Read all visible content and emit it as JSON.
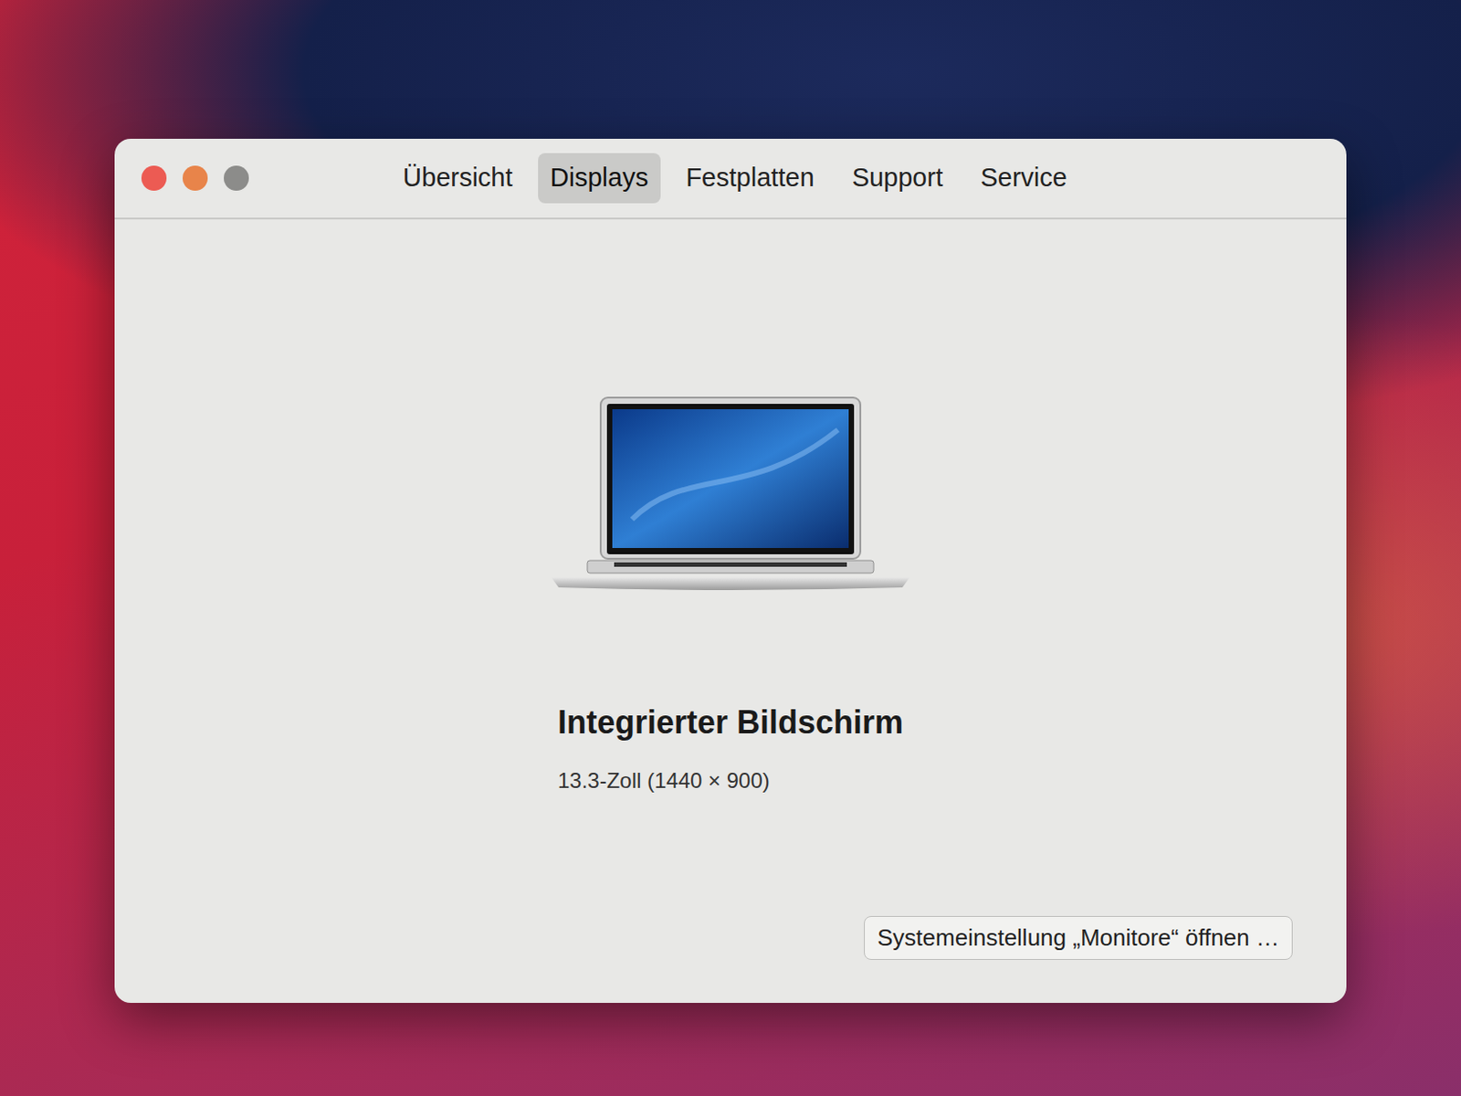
{
  "traffic_lights": [
    {
      "name": "close",
      "color": "#ec5b53"
    },
    {
      "name": "minimize",
      "color": "#e8844a"
    },
    {
      "name": "zoom",
      "color": "#8c8c8a"
    }
  ],
  "tabs": [
    {
      "label": "Übersicht",
      "selected": false
    },
    {
      "label": "Displays",
      "selected": true
    },
    {
      "label": "Festplatten",
      "selected": false
    },
    {
      "label": "Support",
      "selected": false
    },
    {
      "label": "Service",
      "selected": false
    }
  ],
  "display": {
    "name": "Integrierter Bildschirm",
    "detail": "13.3-Zoll (1440 × 900)"
  },
  "buttons": [
    "Systemeinstellung „Monitore“ öffnen …"
  ]
}
